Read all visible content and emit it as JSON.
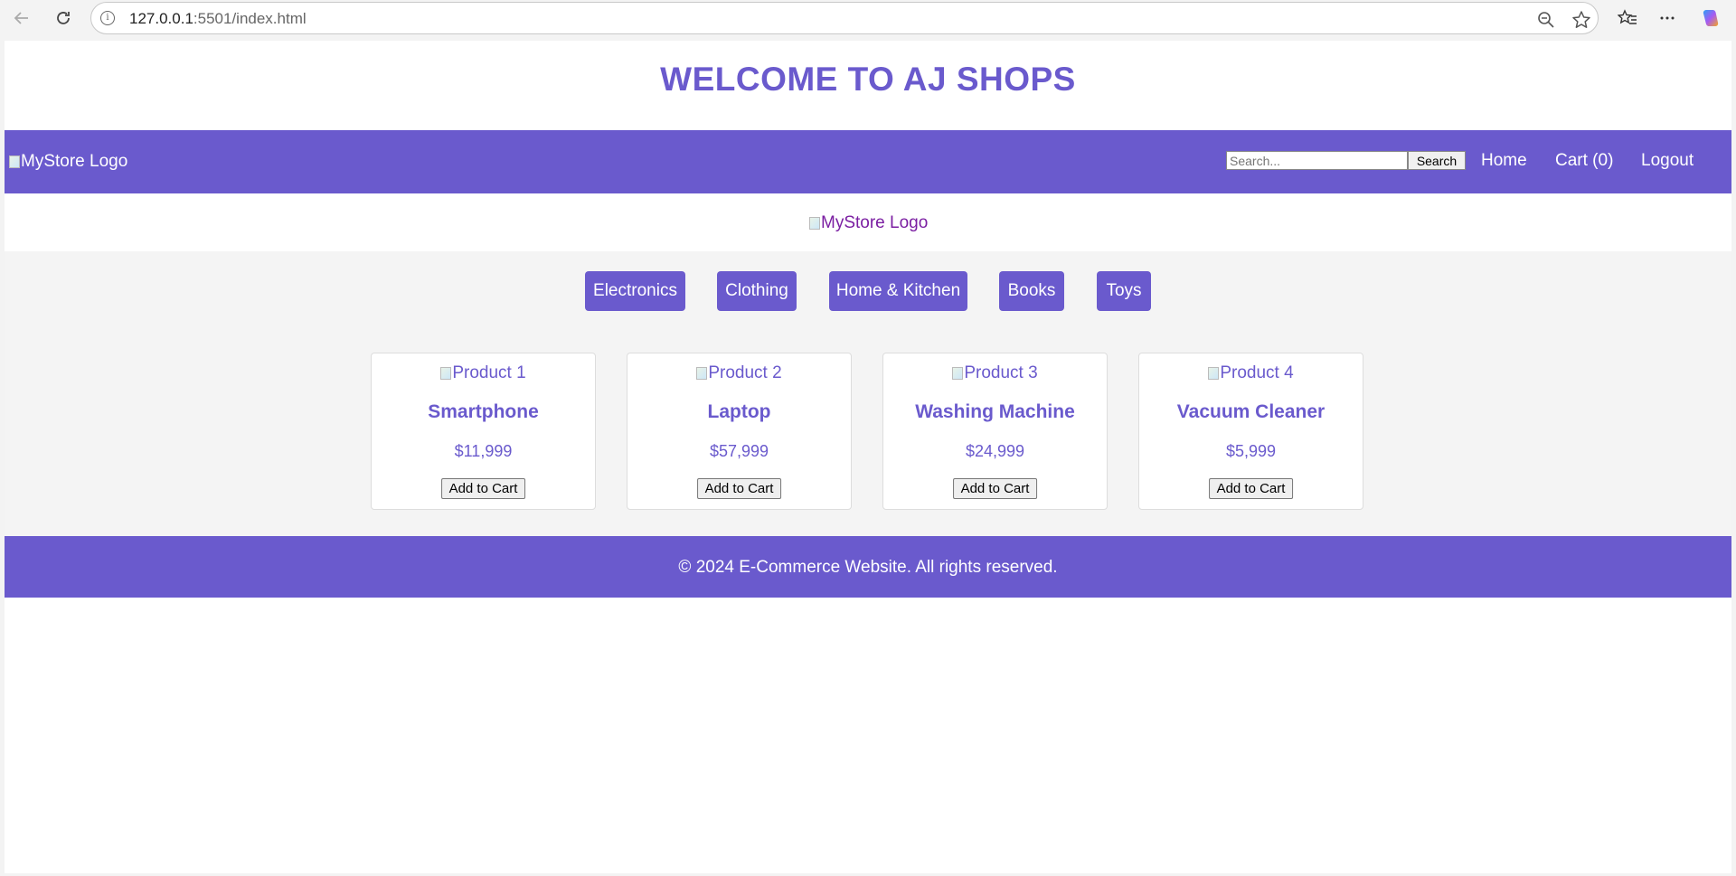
{
  "browser": {
    "url_host": "127.0.0.1",
    "url_rest": ":5501/index.html",
    "icons": {
      "back": "back-arrow-icon",
      "reload": "reload-icon",
      "info": "info-icon",
      "zoom": "zoom-out-icon",
      "favorite": "star-icon",
      "favorites": "favorites-icon",
      "more": "more-icon",
      "copilot": "copilot-icon"
    }
  },
  "site": {
    "title": "WELCOME TO AJ SHOPS",
    "accent_color": "#6a5acd"
  },
  "navbar": {
    "logo_alt": "MyStore Logo",
    "search_placeholder": "Search...",
    "search_label": "Search",
    "links": [
      "Home",
      "Cart (0)",
      "Logout"
    ]
  },
  "logo_row": {
    "logo_alt": "MyStore Logo"
  },
  "categories": [
    "Electronics",
    "Clothing",
    "Home & Kitchen",
    "Books",
    "Toys"
  ],
  "products": [
    {
      "image_alt": "Product 1",
      "name": "Smartphone",
      "price": "$11,999",
      "button": "Add to Cart"
    },
    {
      "image_alt": "Product 2",
      "name": "Laptop",
      "price": "$57,999",
      "button": "Add to Cart"
    },
    {
      "image_alt": "Product 3",
      "name": "Washing Machine",
      "price": "$24,999",
      "button": "Add to Cart"
    },
    {
      "image_alt": "Product 4",
      "name": "Vacuum Cleaner",
      "price": "$5,999",
      "button": "Add to Cart"
    }
  ],
  "footer": {
    "text": "© 2024 E-Commerce Website. All rights reserved."
  }
}
